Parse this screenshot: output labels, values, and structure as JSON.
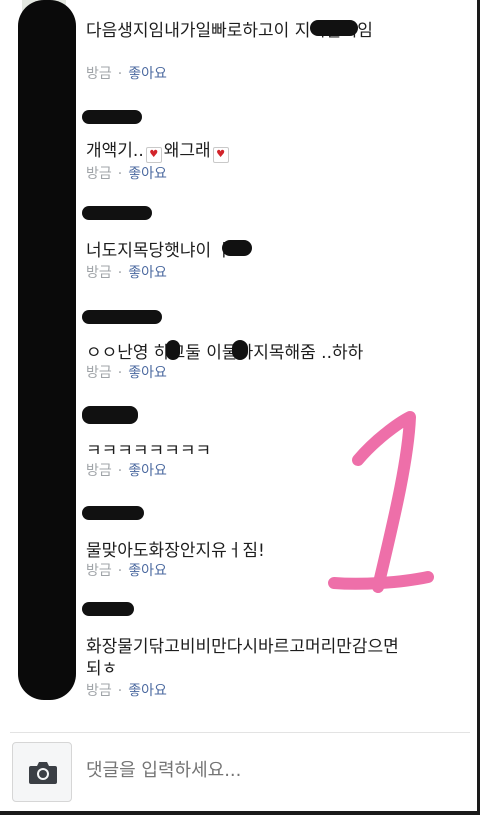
{
  "comments": [
    {
      "text": "다음생지임내가일빠로하고이   지목할거임",
      "time": "방금",
      "like": "좋아요"
    },
    {
      "text_before": "개액기..",
      "text_middle": "왜그래",
      "time": "방금",
      "like": "좋아요"
    },
    {
      "text": "너도지목당햇냐이   ㅏ",
      "time": "방금",
      "like": "좋아요"
    },
    {
      "text": "ㅇㅇ난영   하고둘   이둘다지목해줌 ..하하",
      "time": "방금",
      "like": "좋아요"
    },
    {
      "text": "ㅋㅋㅋㅋㅋㅋㅋㅋ",
      "time": "방금",
      "like": "좋아요"
    },
    {
      "text": "물맞아도화장안지유ㅓ짐!",
      "time": "방금",
      "like": "좋아요"
    },
    {
      "text_line1": "화장물기닦고비비만다시바르고머리만감으면",
      "text_line2": "되ㅎ",
      "time": "방금",
      "like": "좋아요"
    }
  ],
  "composer": {
    "placeholder": "댓글을 입력하세요..."
  },
  "annotation": {
    "mark": "1",
    "color": "#ee6fa9"
  },
  "icons": {
    "camera": "camera-icon",
    "heart": "heart-icon"
  }
}
